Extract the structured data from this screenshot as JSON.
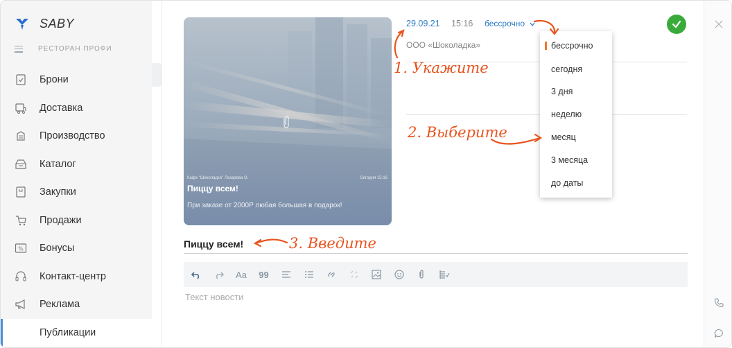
{
  "app": {
    "name": "SABY",
    "org": "РЕСТОРАН ПРОФИ"
  },
  "sidebar": {
    "items": [
      {
        "label": "Брони",
        "icon": "reservation-icon"
      },
      {
        "label": "Доставка",
        "icon": "delivery-icon"
      },
      {
        "label": "Производство",
        "icon": "production-icon"
      },
      {
        "label": "Каталог",
        "icon": "catalog-icon"
      },
      {
        "label": "Закупки",
        "icon": "purchases-icon"
      },
      {
        "label": "Продажи",
        "icon": "sales-icon"
      },
      {
        "label": "Бонусы",
        "icon": "bonus-icon"
      },
      {
        "label": "Контакт-центр",
        "icon": "contact-center-icon"
      },
      {
        "label": "Реклама",
        "icon": "advertising-icon"
      }
    ],
    "sub_item": "Публикации"
  },
  "card": {
    "meta_left": "Кафе \"Шоколадка\"   Лазарева О.",
    "meta_right": "Сегодня 15:16",
    "title": "Пиццу всем!",
    "text": "При заказе от 2000Р любая большая в подарок!"
  },
  "post": {
    "date": "29.09.21",
    "time": "15:16",
    "term": "бессрочно",
    "company": "ООО «Шоколадка»"
  },
  "dropdown": {
    "options": [
      "бессрочно",
      "сегодня",
      "3 дня",
      "неделю",
      "месяц",
      "3 месяца",
      "до даты"
    ],
    "selected": "бессрочно"
  },
  "annotations": {
    "step1": "1. Укажите",
    "step2": "2. Выберите",
    "step3": "3. Введите"
  },
  "editor": {
    "title_value": "Пиццу всем!",
    "text_placeholder": "Текст новости",
    "font_button": "Aa",
    "quote_button": "99"
  },
  "colors": {
    "accent": "#2a7ac4",
    "annotation": "#e8541e",
    "success": "#3aab3a",
    "selection_marker": "#f07a2a"
  }
}
